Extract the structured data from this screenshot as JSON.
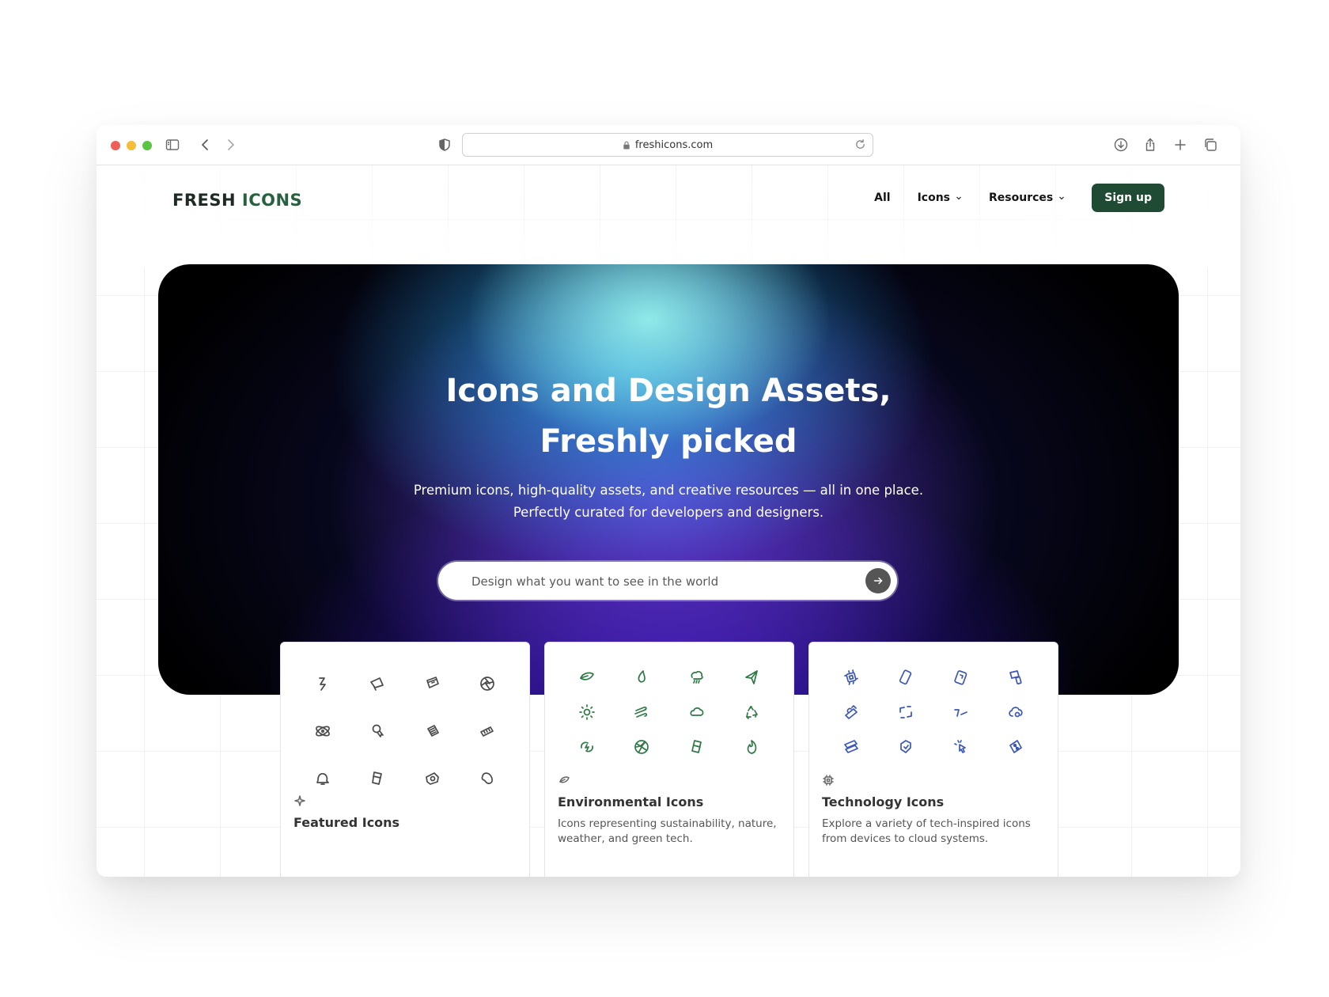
{
  "browser": {
    "url": "freshicons.com",
    "icons": [
      "sidebar-icon",
      "back-icon",
      "forward-icon",
      "shield-icon",
      "lock-icon",
      "reload-icon",
      "download-icon",
      "share-icon",
      "new-tab-icon",
      "tabs-overview-icon"
    ]
  },
  "site": {
    "logo_part1": "FRESH",
    "logo_part2": "ICONS",
    "nav": {
      "all": "All",
      "icons": "Icons",
      "resources": "Resources",
      "signup": "Sign up"
    },
    "hero": {
      "title_line1": "Icons and Design Assets,",
      "title_line2": "Freshly picked",
      "subtitle_line1": "Premium icons, high-quality assets, and creative resources — all in one place.",
      "subtitle_line2": "Perfectly curated for developers and designers.",
      "search_placeholder": "Design what you want to see in the world"
    },
    "cards": [
      {
        "title": "Featured Icons",
        "description": "",
        "color": "#4a4a4a"
      },
      {
        "title": "Environmental Icons",
        "description": "Icons representing sustainability, nature, weather, and green tech.",
        "color": "#2f7a45"
      },
      {
        "title": "Technology Icons",
        "description": "Explore a variety of tech-inspired icons from devices to cloud systems.",
        "color": "#3b57b8"
      }
    ]
  },
  "colors": {
    "brand_dark": "#1f4a33",
    "featured_icon": "#4a4a4a",
    "environmental_icon": "#2f7a45",
    "technology_icon": "#3b57b8"
  }
}
